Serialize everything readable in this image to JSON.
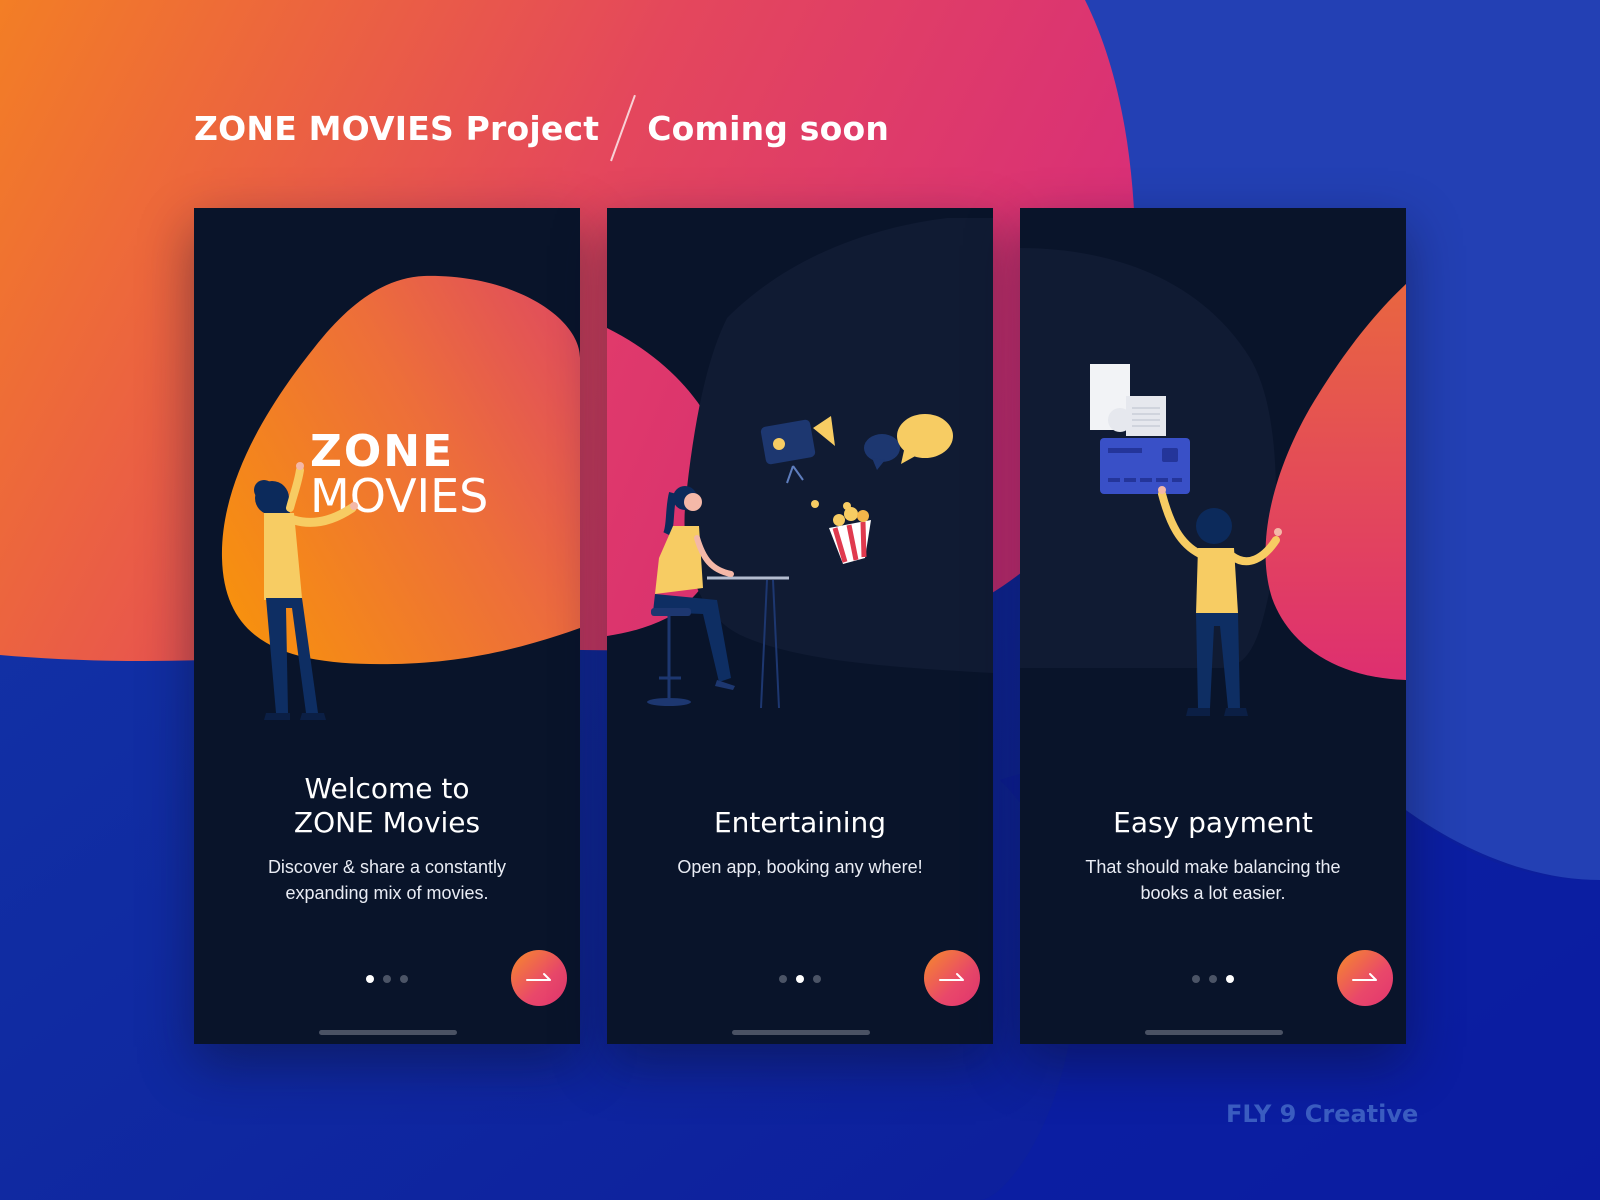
{
  "header": {
    "project": "ZONE MOVIES Project",
    "status": "Coming soon"
  },
  "colors": {
    "background_blue": "#1438a8",
    "gradient_orange": "#f68b2a",
    "gradient_pink": "#e2356f",
    "screen_dark": "#09142a",
    "accent_yellow": "#f7cc63"
  },
  "screens": [
    {
      "logo_line1": "ZONE",
      "logo_line2": "MOVIES",
      "title_line1": "Welcome to",
      "title_line2": "ZONE Movies",
      "desc_line1": "Discover & share a constantly",
      "desc_line2": "expanding mix of movies.",
      "active_dot": 1,
      "next_icon": "arrow-right-icon"
    },
    {
      "title_line1": "Entertaining",
      "desc_line1": "Open app, booking any where!",
      "active_dot": 2,
      "next_icon": "arrow-right-icon"
    },
    {
      "title_line1": "Easy payment",
      "desc_line1": "That should make balancing the",
      "desc_line2": "books a lot easier.",
      "active_dot": 3,
      "next_icon": "arrow-right-icon"
    }
  ],
  "footer": {
    "credit": "FLY 9 Creative"
  }
}
